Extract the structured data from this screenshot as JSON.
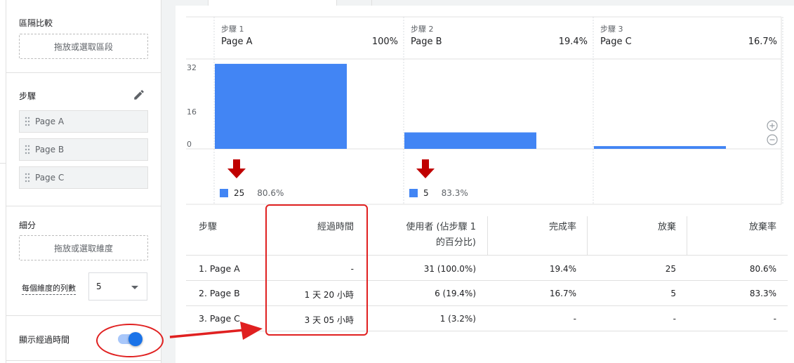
{
  "left_panel": {
    "segment_compare": {
      "title": "區隔比較",
      "drop_placeholder": "拖放或選取區段"
    },
    "steps": {
      "title": "步驟",
      "items": [
        "Page A",
        "Page B",
        "Page C"
      ]
    },
    "breakdown": {
      "title": "細分",
      "drop_placeholder": "拖放或選取維度",
      "rows_per_dimension_label": "每個維度的列數",
      "rows_per_dimension_value": "5"
    },
    "elapsed_time_toggle": {
      "label": "顯示經過時間",
      "on": true
    }
  },
  "chart_data": {
    "type": "bar",
    "steps": [
      {
        "step_label": "步驟 1",
        "name": "Page A",
        "pct": "100%",
        "value": 31
      },
      {
        "step_label": "步驟 2",
        "name": "Page B",
        "pct": "19.4%",
        "value": 6
      },
      {
        "step_label": "步驟 3",
        "name": "Page C",
        "pct": "16.7%",
        "value": 1
      }
    ],
    "y_ticks": [
      "32",
      "16",
      "0"
    ],
    "ylim": [
      0,
      32
    ],
    "dropoffs": [
      {
        "count": "25",
        "pct": "80.6%"
      },
      {
        "count": "5",
        "pct": "83.3%"
      }
    ],
    "bar_color": "#4285f4",
    "dropoff_arrow_color": "#c00000"
  },
  "table": {
    "headers": [
      "步驟",
      "經過時間",
      "使用者 (佔步驟 1",
      "的百分比)",
      "完成率",
      "放棄",
      "放棄率"
    ],
    "rows": [
      [
        "1. Page A",
        "-",
        "31 (100.0%)",
        "19.4%",
        "25",
        "80.6%"
      ],
      [
        "2. Page B",
        "1 天 20 小時",
        "6 (19.4%)",
        "16.7%",
        "5",
        "83.3%"
      ],
      [
        "3. Page C",
        "3 天 05 小時",
        "1 (3.2%)",
        "-",
        "-",
        "-"
      ]
    ]
  },
  "annotation_color": "#e02020"
}
